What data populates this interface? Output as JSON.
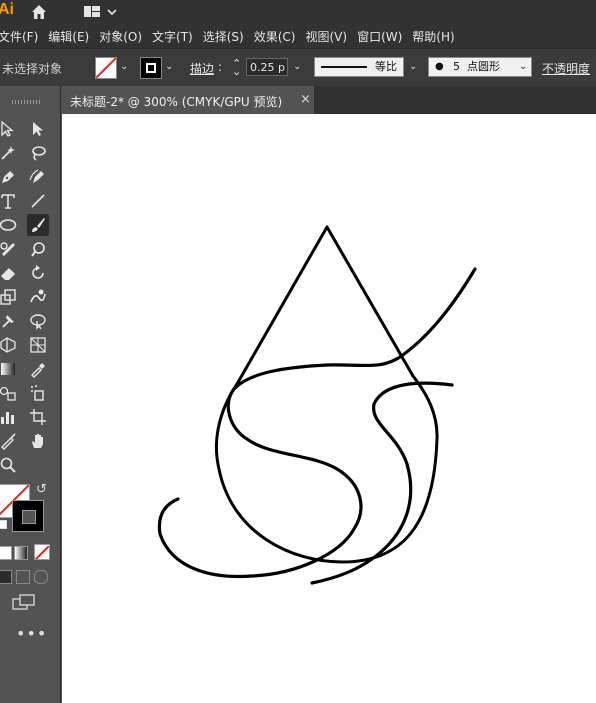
{
  "app": {
    "logo": "Ai"
  },
  "menu": [
    "文件(F)",
    "编辑(E)",
    "对象(O)",
    "文字(T)",
    "选择(S)",
    "效果(C)",
    "视图(V)",
    "窗口(W)",
    "帮助(H)"
  ],
  "control_bar": {
    "selection_status": "未选择对象",
    "stroke_label": "描边",
    "stroke_value": "0.25 p",
    "profile_label": "等比",
    "brush_size": "5",
    "brush_label": "点圆形",
    "opacity_label": "不透明度"
  },
  "document_tab": {
    "title": "未标题-2* @ 300% (CMYK/GPU 预览)",
    "close": "×"
  },
  "colors": {
    "chrome_dark": "#323232",
    "panel": "#535353",
    "accent": "#ff9a00",
    "canvas": "#ffffff"
  },
  "tools": [
    "selection-icon",
    "direct-selection-icon",
    "magic-wand-icon",
    "lasso-icon",
    "pen-icon",
    "curvature-icon",
    "type-icon",
    "line-icon",
    "ellipse-icon",
    "paintbrush-icon",
    "shaper-icon",
    "blob-brush-icon",
    "eraser-icon",
    "rotate-icon",
    "scale-icon",
    "warp-icon",
    "puppet-warp-icon",
    "free-transform-icon",
    "shape-builder-icon",
    "perspective-grid-icon",
    "mesh-icon",
    "gradient-icon",
    "eyedropper-icon",
    "blend-icon",
    "symbol-sprayer-icon",
    "column-graph-icon",
    "artboard-icon",
    "slice-icon",
    "hand-icon",
    "zoom-icon"
  ]
}
